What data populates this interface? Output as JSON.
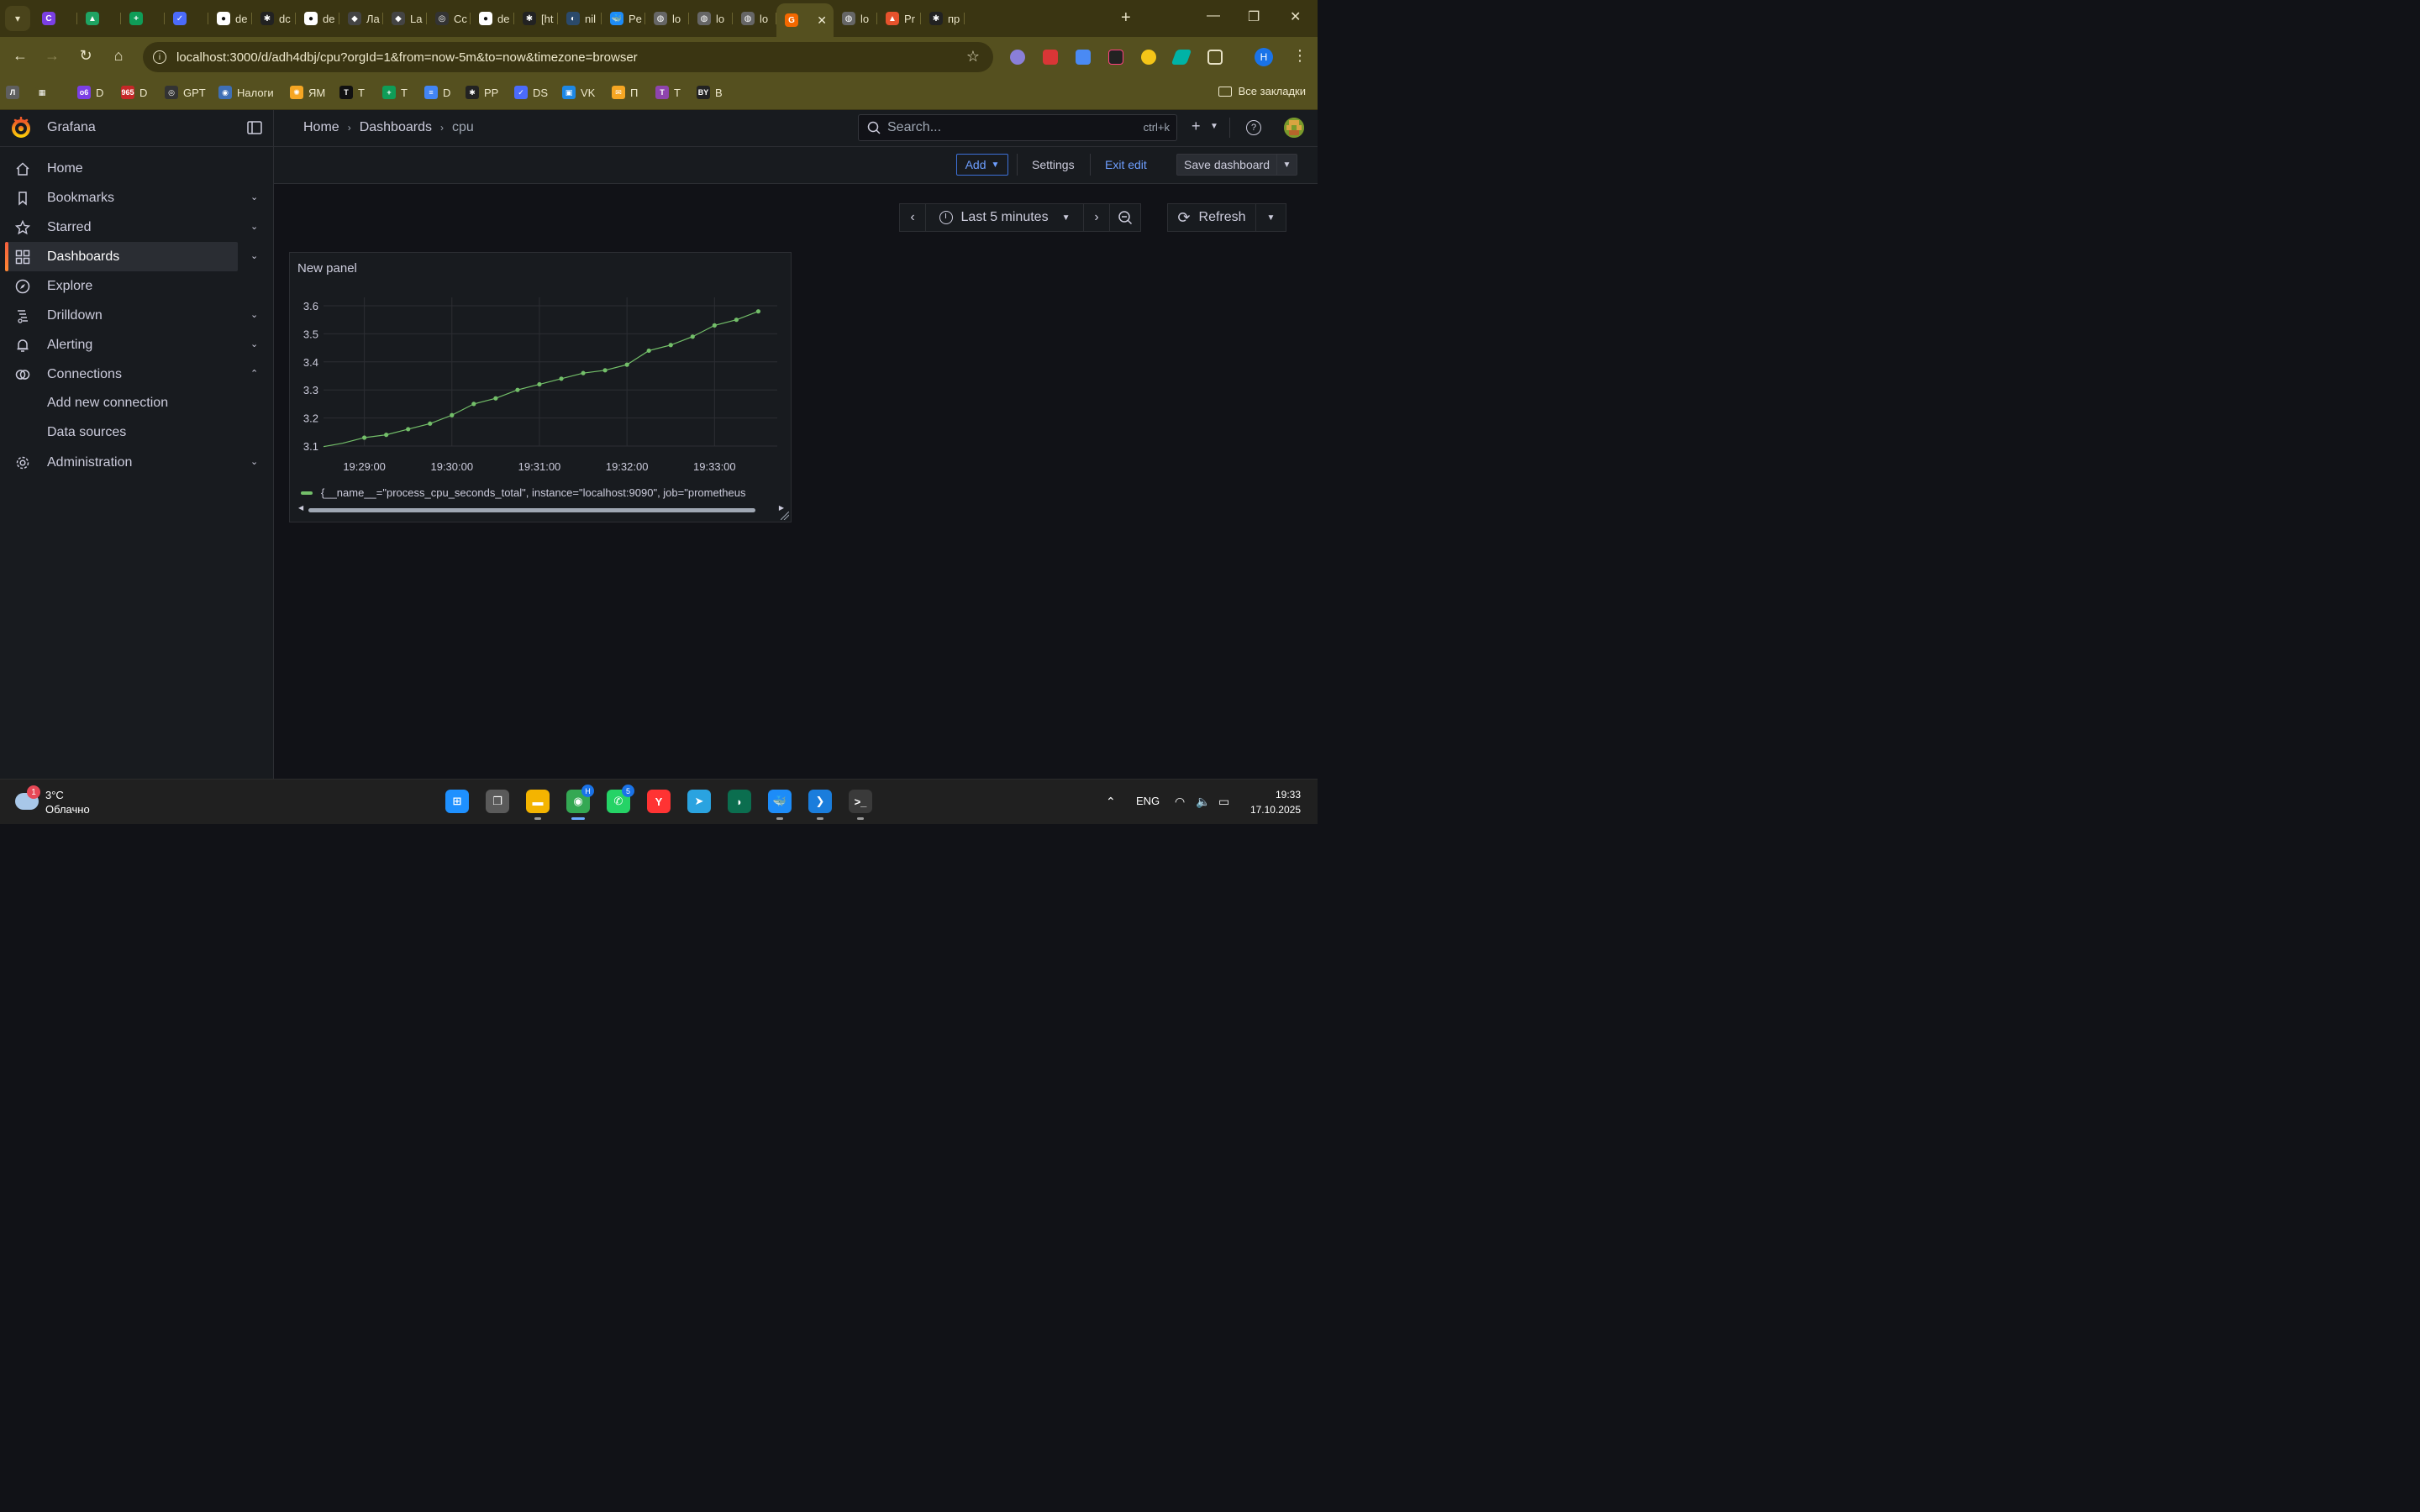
{
  "browser": {
    "tab_menu_icon": "chevron-down-icon",
    "tabs": [
      {
        "label": "",
        "color": "#7b3fe4",
        "glyph": "C"
      },
      {
        "label": "",
        "color": "#1fa463",
        "glyph": "▲"
      },
      {
        "label": "",
        "color": "#0f9d58",
        "glyph": "+"
      },
      {
        "label": "",
        "color": "#4b6bfb",
        "glyph": "✓"
      },
      {
        "label": "de",
        "color": "#ffffff",
        "glyph": "●"
      },
      {
        "label": "dc",
        "color": "#222222",
        "glyph": "✱"
      },
      {
        "label": "de",
        "color": "#ffffff",
        "glyph": "●"
      },
      {
        "label": "Ла",
        "color": "#444444",
        "glyph": "◆"
      },
      {
        "label": "La",
        "color": "#444444",
        "glyph": "◆"
      },
      {
        "label": "Cc",
        "color": "#333333",
        "glyph": "◎"
      },
      {
        "label": "de",
        "color": "#ffffff",
        "glyph": "●"
      },
      {
        "label": "[ht",
        "color": "#222222",
        "glyph": "✱"
      },
      {
        "label": "nil",
        "color": "#2b4a6b",
        "glyph": "◐"
      },
      {
        "label": "Pe",
        "color": "#1d8cf8",
        "glyph": "🐳"
      },
      {
        "label": "lo",
        "color": "#666666",
        "glyph": "◍"
      },
      {
        "label": "lo",
        "color": "#666666",
        "glyph": "◍"
      },
      {
        "label": "lo",
        "color": "#666666",
        "glyph": "◍"
      },
      {
        "label": "",
        "color": "#f46800",
        "glyph": "G",
        "active": true
      },
      {
        "label": "lo",
        "color": "#666666",
        "glyph": "◍"
      },
      {
        "label": "Pr",
        "color": "#e6522c",
        "glyph": "▲"
      },
      {
        "label": "пр",
        "color": "#222222",
        "glyph": "✱"
      }
    ],
    "url": "localhost:3000/d/adh4dbj/cpu?orgId=1&from=now-5m&to=now&timezone=browser",
    "profile_initial": "Н",
    "bookmarks": [
      {
        "label": "",
        "color": "#5f5f5f",
        "glyph": "Л"
      },
      {
        "label": "",
        "color": "#55501f",
        "glyph": "▦"
      },
      {
        "label": "D",
        "color": "#7b3fe4",
        "glyph": "о6"
      },
      {
        "label": "D",
        "color": "#c62828",
        "glyph": "965"
      },
      {
        "label": "GPT",
        "color": "#333333",
        "glyph": "◎"
      },
      {
        "label": "Налоги",
        "color": "#3f6fb5",
        "glyph": "◉"
      },
      {
        "label": "ЯМ",
        "color": "#f5a623",
        "glyph": "✺"
      },
      {
        "label": "Т",
        "color": "#111111",
        "glyph": "Т"
      },
      {
        "label": "Т",
        "color": "#0f9d58",
        "glyph": "+"
      },
      {
        "label": "D",
        "color": "#4285f4",
        "glyph": "≡"
      },
      {
        "label": "РР",
        "color": "#222222",
        "glyph": "✱"
      },
      {
        "label": "DS",
        "color": "#4b6bfb",
        "glyph": "✓"
      },
      {
        "label": "VK",
        "color": "#1e88e5",
        "glyph": "▣"
      },
      {
        "label": "П",
        "color": "#f5a623",
        "glyph": "✉"
      },
      {
        "label": "Т",
        "color": "#8e44ad",
        "glyph": "Т"
      },
      {
        "label": "В",
        "color": "#222222",
        "glyph": "BY"
      }
    ],
    "all_bookmarks": "Все закладки"
  },
  "grafana": {
    "brand": "Grafana",
    "breadcrumb": [
      "Home",
      "Dashboards",
      "cpu"
    ],
    "search_placeholder": "Search...",
    "search_shortcut": "ctrl+k",
    "nav": [
      {
        "label": "Home",
        "icon": "home-icon",
        "chevron": ""
      },
      {
        "label": "Bookmarks",
        "icon": "bookmark-icon",
        "chevron": "down"
      },
      {
        "label": "Starred",
        "icon": "star-icon",
        "chevron": "down"
      },
      {
        "label": "Dashboards",
        "icon": "dashboards-icon",
        "chevron": "down",
        "active": true
      },
      {
        "label": "Explore",
        "icon": "compass-icon",
        "chevron": ""
      },
      {
        "label": "Drilldown",
        "icon": "drilldown-icon",
        "chevron": "down"
      },
      {
        "label": "Alerting",
        "icon": "bell-icon",
        "chevron": "down"
      },
      {
        "label": "Connections",
        "icon": "connections-icon",
        "chevron": "up"
      },
      {
        "label": "Add new connection",
        "sub": true
      },
      {
        "label": "Data sources",
        "sub": true
      },
      {
        "label": "Administration",
        "icon": "gear-icon",
        "chevron": "down"
      }
    ],
    "toolbar": {
      "add_label": "Add",
      "settings_label": "Settings",
      "exit_edit_label": "Exit edit",
      "save_label": "Save dashboard"
    },
    "time_picker": {
      "range_label": "Last 5 minutes",
      "refresh_label": "Refresh"
    },
    "panel": {
      "title": "New panel",
      "legend": "{__name__=\"process_cpu_seconds_total\", instance=\"localhost:9090\", job=\"prometheus"
    },
    "colors": {
      "series": "#73bf69",
      "accent": "#6e9fff",
      "brand": "#f46800"
    }
  },
  "chart_data": {
    "type": "line",
    "title": "New panel",
    "xlabel": "",
    "ylabel": "",
    "x_ticks": [
      "19:29:00",
      "19:30:00",
      "19:31:00",
      "19:32:00",
      "19:33:00"
    ],
    "y_ticks": [
      "3.1",
      "3.2",
      "3.3",
      "3.4",
      "3.5",
      "3.6"
    ],
    "ylim": [
      3.1,
      3.6
    ],
    "x_seconds_from_start": [
      0,
      15,
      30,
      45,
      60,
      75,
      90,
      105,
      120,
      135,
      150,
      165,
      180,
      195,
      210,
      225,
      240,
      255,
      270
    ],
    "series": [
      {
        "name": "{__name__=\"process_cpu_seconds_total\", instance=\"localhost:9090\", job=\"prometheus",
        "values": [
          3.11,
          3.13,
          3.14,
          3.16,
          3.18,
          3.21,
          3.25,
          3.27,
          3.3,
          3.32,
          3.34,
          3.36,
          3.37,
          3.39,
          3.44,
          3.46,
          3.49,
          3.53,
          3.55,
          3.58
        ]
      }
    ],
    "x": [
      "19:28:45",
      "19:29:00",
      "19:29:15",
      "19:29:30",
      "19:29:45",
      "19:30:00",
      "19:30:15",
      "19:30:30",
      "19:30:45",
      "19:31:00",
      "19:31:15",
      "19:31:30",
      "19:31:45",
      "19:32:00",
      "19:32:15",
      "19:32:30",
      "19:32:45",
      "19:33:00",
      "19:33:15",
      "19:33:30"
    ],
    "grid": true,
    "legend_position": "bottom"
  },
  "taskbar": {
    "weather_temp": "3°C",
    "weather_desc": "Облачно",
    "weather_badge": "1",
    "apps": [
      {
        "name": "start",
        "color": "#1e90ff",
        "glyph": "⊞"
      },
      {
        "name": "taskview",
        "color": "#5a5a5a",
        "glyph": "❐"
      },
      {
        "name": "explorer",
        "color": "#f4b400",
        "glyph": "▬"
      },
      {
        "name": "chrome",
        "color": "#34a853",
        "glyph": "◉",
        "badge": "Н"
      },
      {
        "name": "whatsapp",
        "color": "#25d366",
        "glyph": "✆",
        "badge": "5"
      },
      {
        "name": "yandex",
        "color": "#ff3333",
        "glyph": "Y"
      },
      {
        "name": "telegram",
        "color": "#2aa3e0",
        "glyph": "➤"
      },
      {
        "name": "app",
        "color": "#0b6e4f",
        "glyph": "◗"
      },
      {
        "name": "docker",
        "color": "#1d8cf8",
        "glyph": "🐳"
      },
      {
        "name": "vscode",
        "color": "#1a7ddc",
        "glyph": "❯"
      },
      {
        "name": "terminal",
        "color": "#3a3a3a",
        "glyph": ">_"
      }
    ],
    "lang": "ENG",
    "time": "19:33",
    "date": "17.10.2025"
  }
}
